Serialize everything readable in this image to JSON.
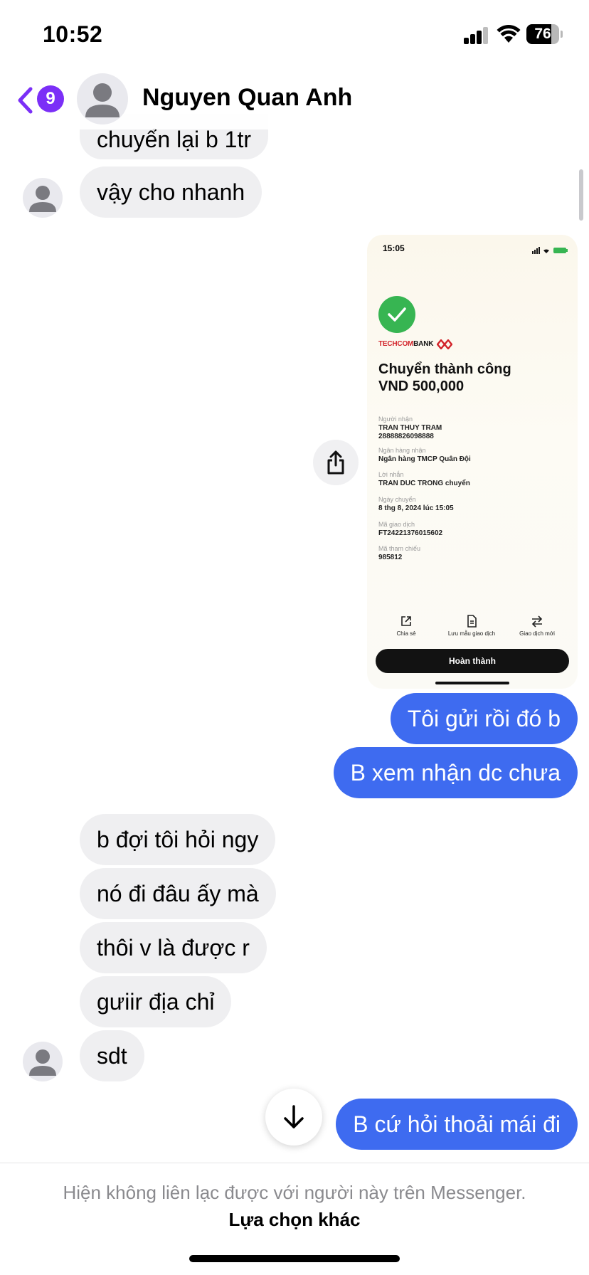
{
  "status_bar": {
    "time": "10:52",
    "battery": "76",
    "battery_level": 0.76
  },
  "header": {
    "back_badge": "9",
    "contact_name": "Nguyen Quan Anh"
  },
  "messages": [
    {
      "from": "them",
      "text": "chuyển lại b 1tr"
    },
    {
      "from": "them",
      "text": "vậy cho nhanh"
    },
    {
      "from": "me",
      "type": "image",
      "text": ""
    },
    {
      "from": "me",
      "text": "Tôi gửi rồi đó b"
    },
    {
      "from": "me",
      "text": "B xem nhận dc chưa"
    },
    {
      "from": "them",
      "text": "b đợi tôi hỏi ngy"
    },
    {
      "from": "them",
      "text": "nó đi đâu ấy mà"
    },
    {
      "from": "them",
      "text": "thôi v là được r"
    },
    {
      "from": "them",
      "text": "gưiir địa chỉ"
    },
    {
      "from": "them",
      "text": "sdt"
    },
    {
      "from": "me",
      "text": "B cứ hỏi thoải mái đi"
    }
  ],
  "shared_image": {
    "time": "15:05",
    "bank_red": "TECHCOM",
    "bank_black": "BANK",
    "title": "Chuyển thành công",
    "amount": "VND 500,000",
    "fields": [
      {
        "label": "Người nhận",
        "value": "TRAN THUY TRAM",
        "value2": "28888826098888"
      },
      {
        "label": "Ngân hàng nhận",
        "value": "Ngân hàng TMCP Quân Đội"
      },
      {
        "label": "Lời nhắn",
        "value": "TRAN DUC TRONG chuyển"
      },
      {
        "label": "Ngày chuyển",
        "value": "8 thg 8, 2024 lúc 15:05"
      },
      {
        "label": "Mã giao dịch",
        "value": "FT24221376015602"
      },
      {
        "label": "Mã tham chiếu",
        "value": "985812"
      }
    ],
    "actions": [
      "Chia sẻ",
      "Lưu mẫu giao dịch",
      "Giao dịch mới"
    ],
    "done_button": "Hoàn thành"
  },
  "footer": {
    "notice": "Hiện không liên lạc được với người này trên Messenger.",
    "link": "Lựa chọn khác"
  },
  "colors": {
    "outgoing": "#3e6bf0",
    "incoming": "#efeff1",
    "accent": "#7b2ff7",
    "success": "#37b552",
    "bank_red": "#d2232a"
  }
}
